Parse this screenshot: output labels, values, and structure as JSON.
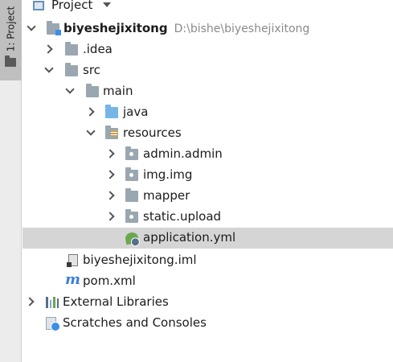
{
  "panel": {
    "strip_label": "1: Project",
    "title": "Project"
  },
  "tree": {
    "root": {
      "label": "biyeshejixitong",
      "path": "D:\\bishe\\biyeshejixitong"
    },
    "items": [
      {
        "label": ".idea"
      },
      {
        "label": "src"
      },
      {
        "label": "main"
      },
      {
        "label": "java"
      },
      {
        "label": "resources"
      },
      {
        "label": "admin.admin"
      },
      {
        "label": "img.img"
      },
      {
        "label": "mapper"
      },
      {
        "label": "static.upload"
      },
      {
        "label": "application.yml"
      },
      {
        "label": "biyeshejixitong.iml"
      },
      {
        "label": "pom.xml"
      },
      {
        "label": "External Libraries"
      },
      {
        "label": "Scratches and Consoles"
      }
    ],
    "pom_glyph": "m"
  },
  "colors": {
    "selection": "#d5d5d5",
    "folder": "#9aa7b0",
    "source_folder": "#75b6e7",
    "maven": "#3d7ed9"
  }
}
